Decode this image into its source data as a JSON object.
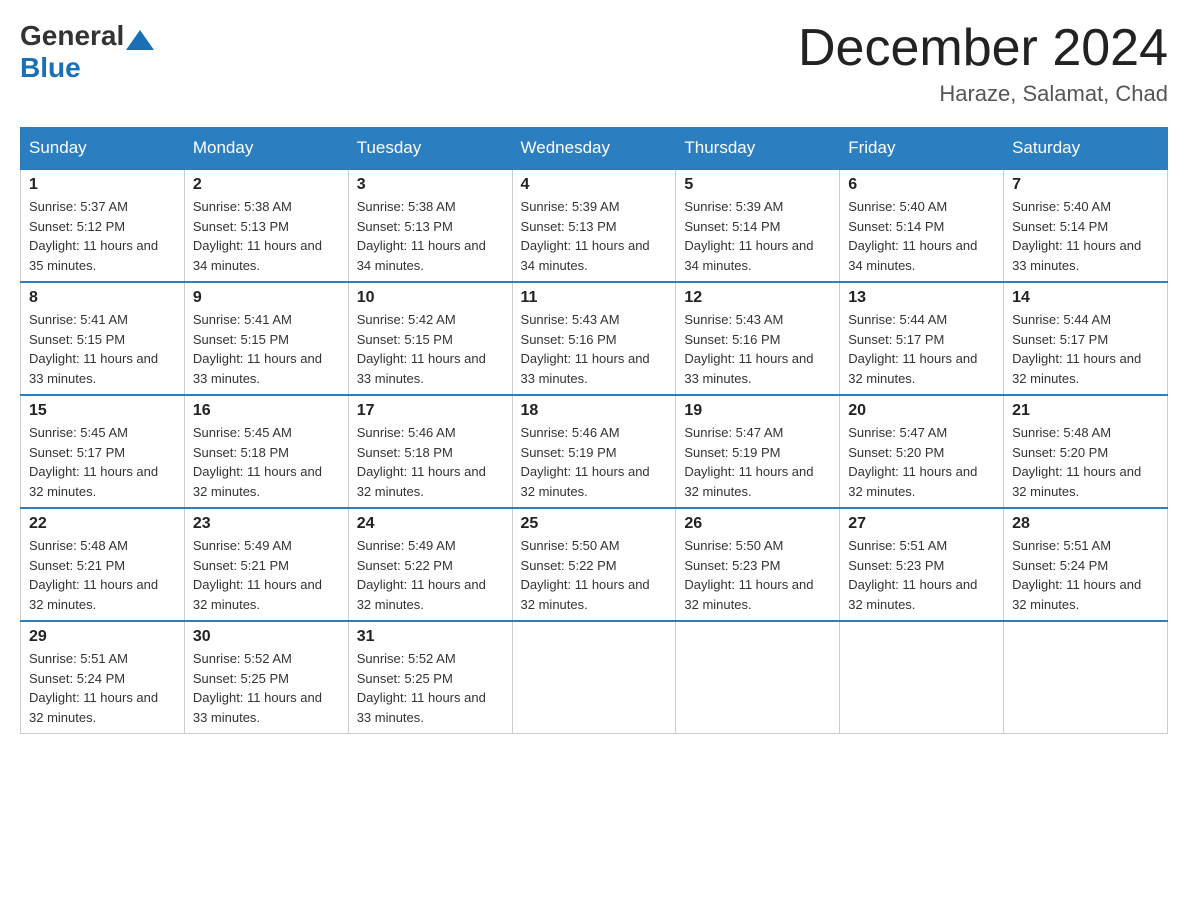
{
  "header": {
    "logo_general": "General",
    "logo_blue": "Blue",
    "month_year": "December 2024",
    "location": "Haraze, Salamat, Chad"
  },
  "days_of_week": [
    "Sunday",
    "Monday",
    "Tuesday",
    "Wednesday",
    "Thursday",
    "Friday",
    "Saturday"
  ],
  "weeks": [
    [
      {
        "day": "1",
        "sunrise": "5:37 AM",
        "sunset": "5:12 PM",
        "daylight": "11 hours and 35 minutes."
      },
      {
        "day": "2",
        "sunrise": "5:38 AM",
        "sunset": "5:13 PM",
        "daylight": "11 hours and 34 minutes."
      },
      {
        "day": "3",
        "sunrise": "5:38 AM",
        "sunset": "5:13 PM",
        "daylight": "11 hours and 34 minutes."
      },
      {
        "day": "4",
        "sunrise": "5:39 AM",
        "sunset": "5:13 PM",
        "daylight": "11 hours and 34 minutes."
      },
      {
        "day": "5",
        "sunrise": "5:39 AM",
        "sunset": "5:14 PM",
        "daylight": "11 hours and 34 minutes."
      },
      {
        "day": "6",
        "sunrise": "5:40 AM",
        "sunset": "5:14 PM",
        "daylight": "11 hours and 34 minutes."
      },
      {
        "day": "7",
        "sunrise": "5:40 AM",
        "sunset": "5:14 PM",
        "daylight": "11 hours and 33 minutes."
      }
    ],
    [
      {
        "day": "8",
        "sunrise": "5:41 AM",
        "sunset": "5:15 PM",
        "daylight": "11 hours and 33 minutes."
      },
      {
        "day": "9",
        "sunrise": "5:41 AM",
        "sunset": "5:15 PM",
        "daylight": "11 hours and 33 minutes."
      },
      {
        "day": "10",
        "sunrise": "5:42 AM",
        "sunset": "5:15 PM",
        "daylight": "11 hours and 33 minutes."
      },
      {
        "day": "11",
        "sunrise": "5:43 AM",
        "sunset": "5:16 PM",
        "daylight": "11 hours and 33 minutes."
      },
      {
        "day": "12",
        "sunrise": "5:43 AM",
        "sunset": "5:16 PM",
        "daylight": "11 hours and 33 minutes."
      },
      {
        "day": "13",
        "sunrise": "5:44 AM",
        "sunset": "5:17 PM",
        "daylight": "11 hours and 32 minutes."
      },
      {
        "day": "14",
        "sunrise": "5:44 AM",
        "sunset": "5:17 PM",
        "daylight": "11 hours and 32 minutes."
      }
    ],
    [
      {
        "day": "15",
        "sunrise": "5:45 AM",
        "sunset": "5:17 PM",
        "daylight": "11 hours and 32 minutes."
      },
      {
        "day": "16",
        "sunrise": "5:45 AM",
        "sunset": "5:18 PM",
        "daylight": "11 hours and 32 minutes."
      },
      {
        "day": "17",
        "sunrise": "5:46 AM",
        "sunset": "5:18 PM",
        "daylight": "11 hours and 32 minutes."
      },
      {
        "day": "18",
        "sunrise": "5:46 AM",
        "sunset": "5:19 PM",
        "daylight": "11 hours and 32 minutes."
      },
      {
        "day": "19",
        "sunrise": "5:47 AM",
        "sunset": "5:19 PM",
        "daylight": "11 hours and 32 minutes."
      },
      {
        "day": "20",
        "sunrise": "5:47 AM",
        "sunset": "5:20 PM",
        "daylight": "11 hours and 32 minutes."
      },
      {
        "day": "21",
        "sunrise": "5:48 AM",
        "sunset": "5:20 PM",
        "daylight": "11 hours and 32 minutes."
      }
    ],
    [
      {
        "day": "22",
        "sunrise": "5:48 AM",
        "sunset": "5:21 PM",
        "daylight": "11 hours and 32 minutes."
      },
      {
        "day": "23",
        "sunrise": "5:49 AM",
        "sunset": "5:21 PM",
        "daylight": "11 hours and 32 minutes."
      },
      {
        "day": "24",
        "sunrise": "5:49 AM",
        "sunset": "5:22 PM",
        "daylight": "11 hours and 32 minutes."
      },
      {
        "day": "25",
        "sunrise": "5:50 AM",
        "sunset": "5:22 PM",
        "daylight": "11 hours and 32 minutes."
      },
      {
        "day": "26",
        "sunrise": "5:50 AM",
        "sunset": "5:23 PM",
        "daylight": "11 hours and 32 minutes."
      },
      {
        "day": "27",
        "sunrise": "5:51 AM",
        "sunset": "5:23 PM",
        "daylight": "11 hours and 32 minutes."
      },
      {
        "day": "28",
        "sunrise": "5:51 AM",
        "sunset": "5:24 PM",
        "daylight": "11 hours and 32 minutes."
      }
    ],
    [
      {
        "day": "29",
        "sunrise": "5:51 AM",
        "sunset": "5:24 PM",
        "daylight": "11 hours and 32 minutes."
      },
      {
        "day": "30",
        "sunrise": "5:52 AM",
        "sunset": "5:25 PM",
        "daylight": "11 hours and 33 minutes."
      },
      {
        "day": "31",
        "sunrise": "5:52 AM",
        "sunset": "5:25 PM",
        "daylight": "11 hours and 33 minutes."
      },
      null,
      null,
      null,
      null
    ]
  ]
}
